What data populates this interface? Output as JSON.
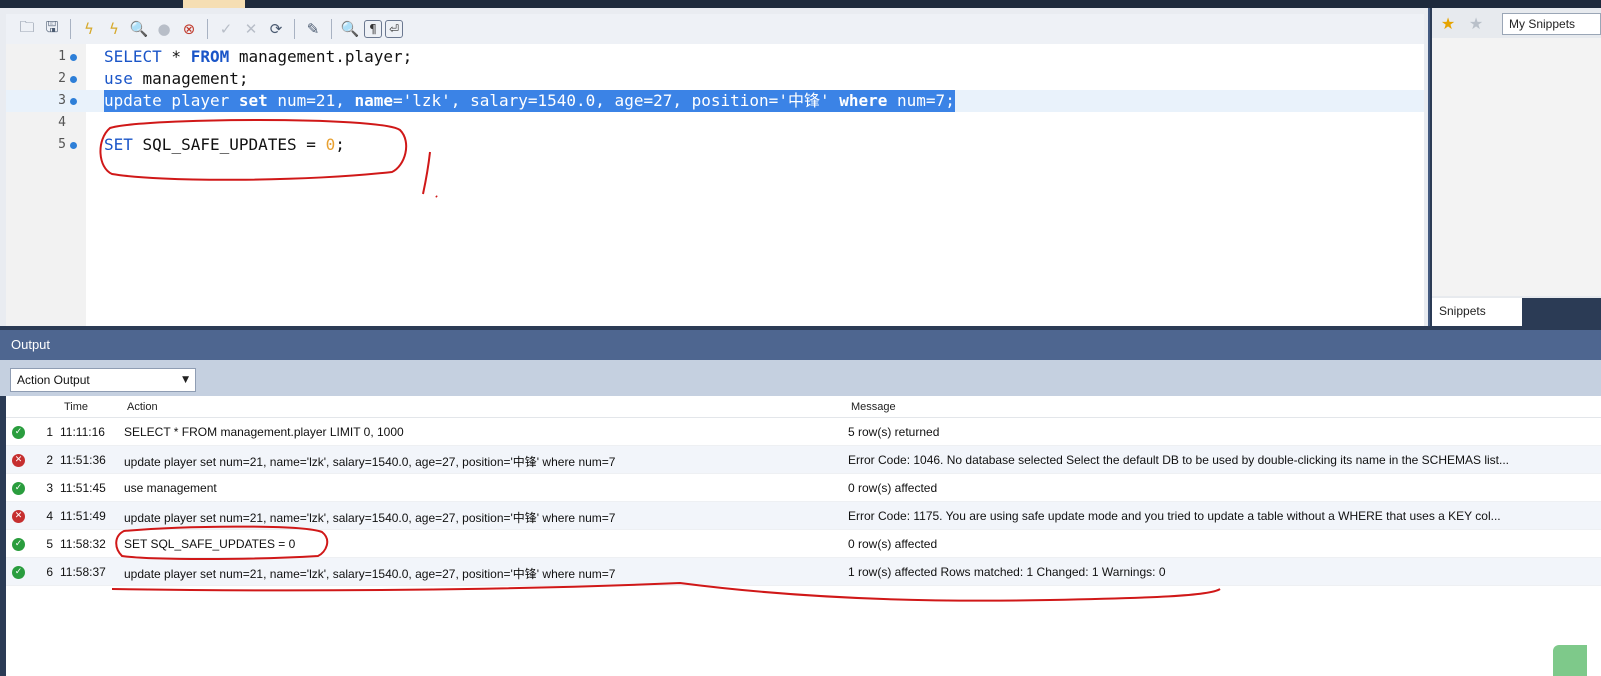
{
  "toolbar": {
    "buttons": [
      {
        "name": "open-file-icon",
        "glyph": "🗀"
      },
      {
        "name": "save-icon",
        "glyph": "🖫"
      },
      {
        "name": "execute-icon",
        "glyph": "ϟ"
      },
      {
        "name": "execute-current-icon",
        "glyph": "ϟ"
      },
      {
        "name": "explain-icon",
        "glyph": "🔍"
      },
      {
        "name": "stop-icon",
        "glyph": "●"
      },
      {
        "name": "toggle-error-icon",
        "glyph": "⊗"
      },
      {
        "name": "commit-icon",
        "glyph": "✓"
      },
      {
        "name": "rollback-icon",
        "glyph": "✕"
      },
      {
        "name": "autocommit-icon",
        "glyph": "⟳"
      },
      {
        "name": "beautify-icon",
        "glyph": "✎"
      },
      {
        "name": "find-icon",
        "glyph": "🔍"
      },
      {
        "name": "invisibles-icon",
        "glyph": "¶"
      },
      {
        "name": "wrap-icon",
        "glyph": "⏎"
      }
    ]
  },
  "editor": {
    "lines": [
      {
        "n": "1",
        "dot": true
      },
      {
        "n": "2",
        "dot": true
      },
      {
        "n": "3",
        "dot": true
      },
      {
        "n": "4",
        "dot": false
      },
      {
        "n": "5",
        "dot": true
      }
    ],
    "l1": {
      "k1": "SELECT",
      "t1": " * ",
      "k2": "FROM",
      "t2": " management.player;"
    },
    "l2": {
      "k1": "use",
      "t1": " management;"
    },
    "l3": {
      "k1": "update",
      "t1": " player ",
      "k2": "set",
      "t2": " num=21, ",
      "k3": "name",
      "t3": "='lzk', salary=1540.0, age=27, position='中锋' ",
      "k4": "where",
      "t4": " num=7;"
    },
    "l5": {
      "k1": "SET",
      "t1": " SQL_SAFE_UPDATES = ",
      "v": "0",
      "t2": ";"
    }
  },
  "snippets": {
    "select_value": "My Snippets",
    "tab_label": "Snippets"
  },
  "output": {
    "title": "Output",
    "filter_value": "Action Output",
    "columns": {
      "time": "Time",
      "action": "Action",
      "message": "Message"
    },
    "rows": [
      {
        "idx": "1",
        "status": "ok",
        "time": "11:11:16",
        "action": "SELECT * FROM management.player LIMIT 0, 1000",
        "message": "5 row(s) returned"
      },
      {
        "idx": "2",
        "status": "err",
        "time": "11:51:36",
        "action": "update player set num=21, name='lzk', salary=1540.0, age=27, position='中锋' where num=7",
        "message": "Error Code: 1046. No database selected Select the default DB to be used by double-clicking its name in the SCHEMAS list..."
      },
      {
        "idx": "3",
        "status": "ok",
        "time": "11:51:45",
        "action": "use management",
        "message": "0 row(s) affected"
      },
      {
        "idx": "4",
        "status": "err",
        "time": "11:51:49",
        "action": "update player set num=21, name='lzk', salary=1540.0, age=27, position='中锋' where num=7",
        "message": "Error Code: 1175. You are using safe update mode and you tried to update a table without a WHERE that uses a KEY col..."
      },
      {
        "idx": "5",
        "status": "ok",
        "time": "11:58:32",
        "action": "SET SQL_SAFE_UPDATES = 0",
        "message": "0 row(s) affected"
      },
      {
        "idx": "6",
        "status": "ok",
        "time": "11:58:37",
        "action": "update player set num=21, name='lzk', salary=1540.0, age=27, position='中锋' where num=7",
        "message": "1 row(s) affected Rows matched: 1  Changed: 1  Warnings: 0"
      }
    ]
  },
  "colors": {
    "keyword": "#1a55c8",
    "selection": "#3b83e6",
    "ok": "#2a9d3e",
    "error": "#c62f2f",
    "annotation": "#d01818"
  }
}
